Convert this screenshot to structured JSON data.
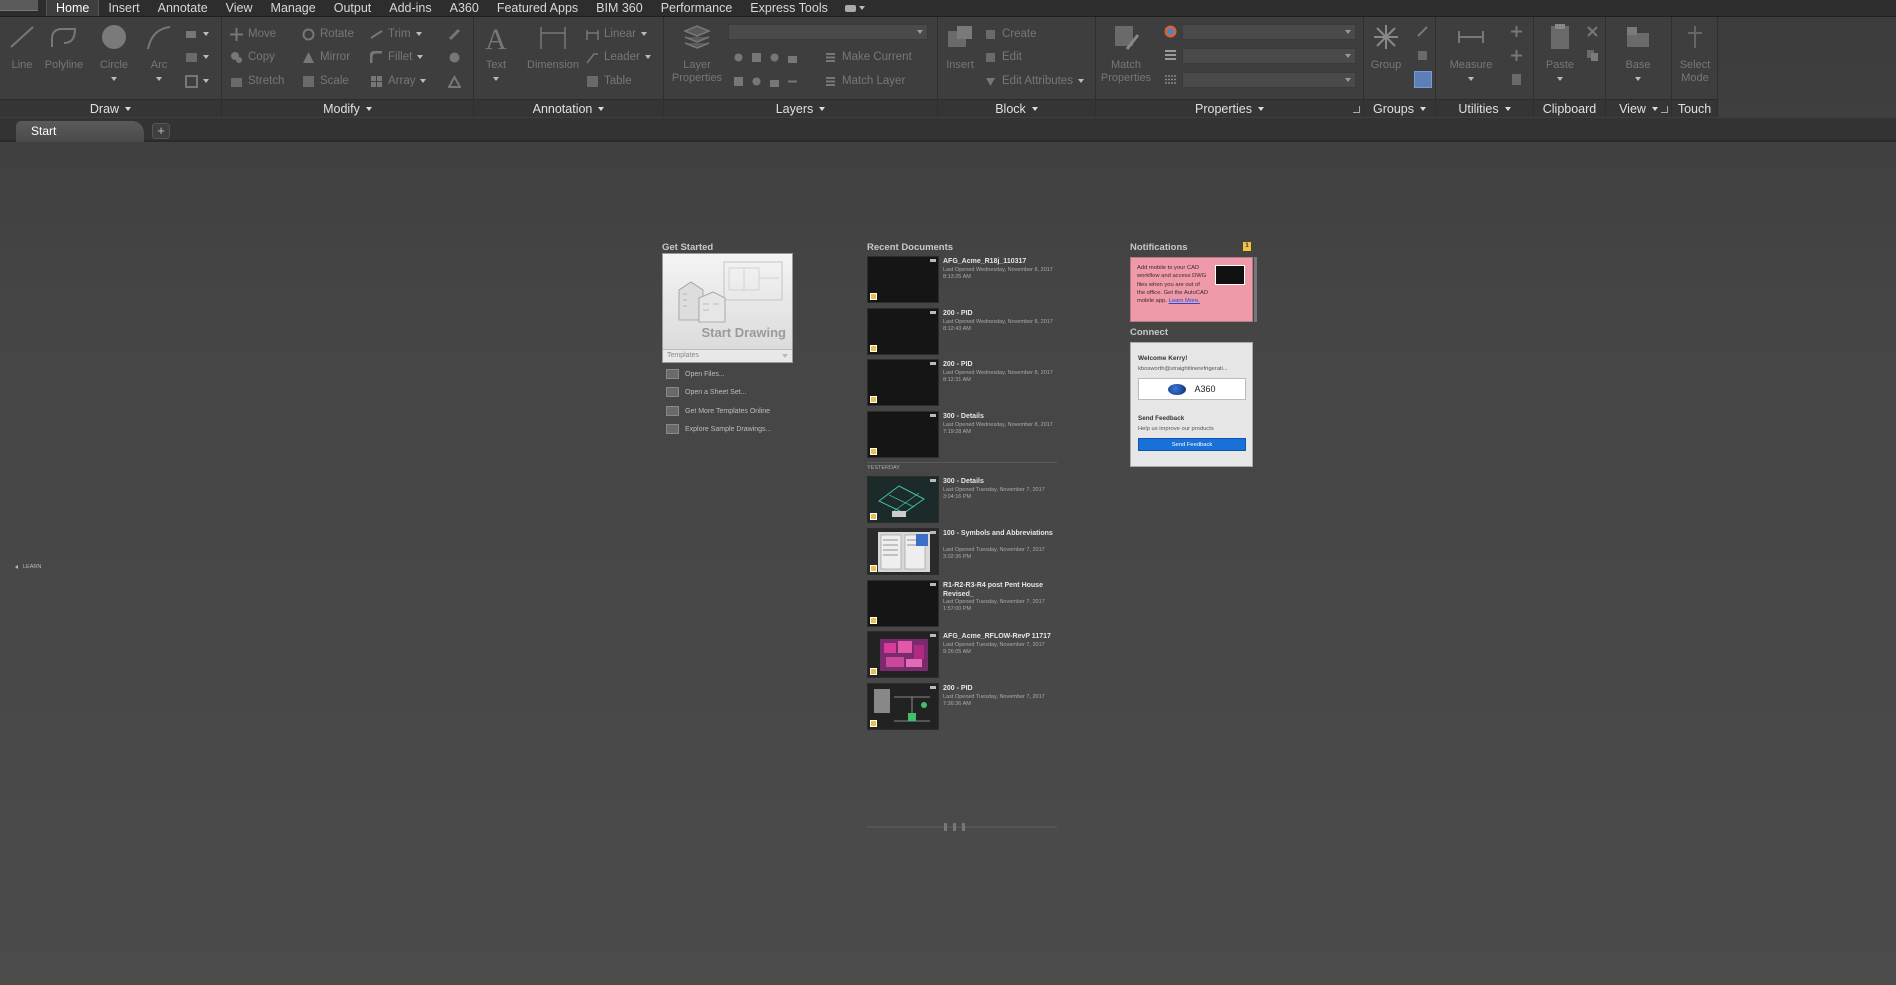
{
  "menu": {
    "tabs": [
      "Home",
      "Insert",
      "Annotate",
      "View",
      "Manage",
      "Output",
      "Add-ins",
      "A360",
      "Featured Apps",
      "BIM 360",
      "Performance",
      "Express Tools"
    ],
    "active": "Home"
  },
  "ribbon": {
    "draw": {
      "label": "Draw",
      "line": "Line",
      "polyline": "Polyline",
      "circle": "Circle",
      "arc": "Arc"
    },
    "modify": {
      "label": "Modify",
      "move": "Move",
      "rotate": "Rotate",
      "trim": "Trim",
      "copy": "Copy",
      "mirror": "Mirror",
      "fillet": "Fillet",
      "stretch": "Stretch",
      "scale": "Scale",
      "array": "Array"
    },
    "annotation": {
      "label": "Annotation",
      "text": "Text",
      "dimension": "Dimension",
      "linear": "Linear",
      "leader": "Leader",
      "table": "Table"
    },
    "layers": {
      "label": "Layers",
      "layer_properties_1": "Layer",
      "layer_properties_2": "Properties",
      "make_current": "Make Current",
      "match_layer": "Match Layer"
    },
    "block": {
      "label": "Block",
      "insert": "Insert",
      "create": "Create",
      "edit": "Edit",
      "edit_attributes": "Edit Attributes"
    },
    "properties": {
      "label": "Properties",
      "match_1": "Match",
      "match_2": "Properties"
    },
    "groups": {
      "label": "Groups",
      "group": "Group"
    },
    "utilities": {
      "label": "Utilities",
      "measure": "Measure"
    },
    "clipboard": {
      "label": "Clipboard",
      "paste": "Paste"
    },
    "view": {
      "label": "View",
      "base": "Base"
    },
    "touch": {
      "label": "Touch",
      "select_1": "Select",
      "select_2": "Mode"
    }
  },
  "doc_tabs": {
    "tabs": [
      "Start"
    ],
    "add": "+"
  },
  "get_started": {
    "heading": "Get Started",
    "start_drawing": "Start Drawing",
    "templates": "Templates",
    "links": [
      "Open Files...",
      "Open a Sheet Set...",
      "Get More Templates Online",
      "Explore Sample Drawings..."
    ]
  },
  "recent": {
    "heading": "Recent Documents",
    "group_label": "YESTERDAY",
    "docs": [
      {
        "name": "AFG_Acme_R18j_110317",
        "date": "Last Opened Wednesday, November 8, 2017 8:13:25 AM",
        "thumb": "dark"
      },
      {
        "name": "200 - PID",
        "date": "Last Opened Wednesday, November 8, 2017 8:12:43 AM",
        "thumb": "dark"
      },
      {
        "name": "200 - PID",
        "date": "Last Opened Wednesday, November 8, 2017 8:12:31 AM",
        "thumb": "dark"
      },
      {
        "name": "300 - Details",
        "date": "Last Opened Wednesday, November 8, 2017 7:19:28 AM",
        "thumb": "dark"
      },
      {
        "name": "300 - Details",
        "date": "Last Opened Tuesday, November 7, 2017 3:04:16 PM",
        "thumb": "details"
      },
      {
        "name": "100 - Symbols and Abbreviations",
        "date": "Last Opened Tuesday, November 7, 2017 3:02:36 PM",
        "thumb": "symbols"
      },
      {
        "name": "R1-R2-R3-R4 post Pent House Revised_",
        "date": "Last Opened Tuesday, November 7, 2017 1:57:00 PM",
        "thumb": "dark"
      },
      {
        "name": "AFG_Acme_RFLOW-RevP 11717",
        "date": "Last Opened Tuesday, November 7, 2017 9:26:05 AM",
        "thumb": "colorful"
      },
      {
        "name": "200 - PID",
        "date": "Last Opened Tuesday, November 7, 2017 7:36:36 AM",
        "thumb": "pid"
      }
    ]
  },
  "notifications": {
    "heading": "Notifications",
    "badge": "1",
    "text": "Add mobile to your CAD workflow and access DWG files when you are out of the office. Get the AutoCAD mobile app.",
    "link": "Learn More."
  },
  "connect": {
    "heading": "Connect",
    "welcome": "Welcome Kerry!",
    "email": "kbosworth@straightlinerefrigerati...",
    "a360": "A360",
    "feedback_title": "Send Feedback",
    "feedback_sub": "Help us improve our products",
    "feedback_button": "Send Feedback"
  },
  "side": {
    "learn": "LEARN"
  },
  "colors": {
    "accent_blue": "#1970d8",
    "notif_pink": "#ef9aa8",
    "badge_yellow": "#f2c43a"
  }
}
